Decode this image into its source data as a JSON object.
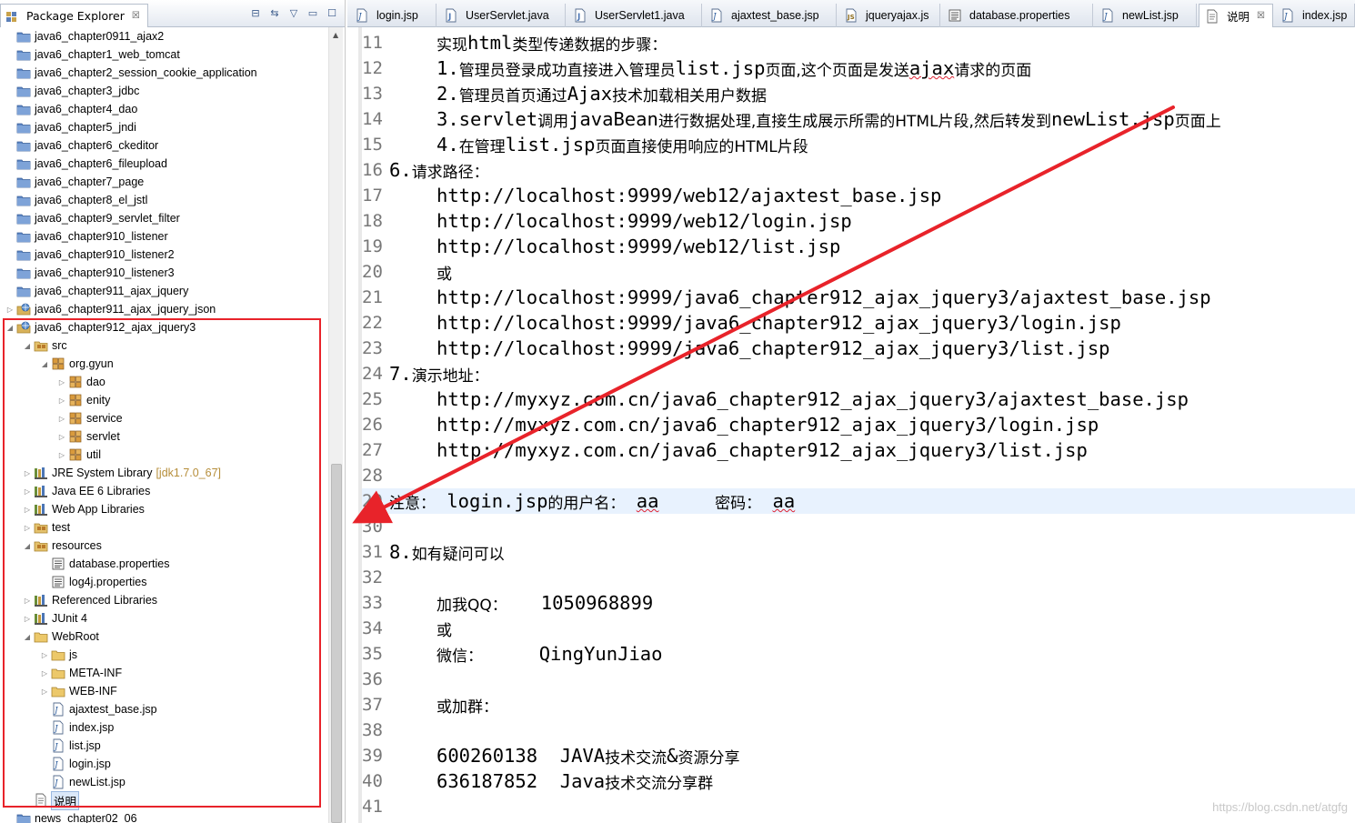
{
  "explorer": {
    "title": "Package Explorer",
    "tools": [
      "collapse-all-icon",
      "link-with-editor-icon",
      "view-menu-icon",
      "minimize-icon",
      "maximize-icon"
    ],
    "items": [
      {
        "label": "java6_chapter0911_ajax2",
        "level": 1,
        "icon": "project-icon",
        "twisty": ""
      },
      {
        "label": "java6_chapter1_web_tomcat",
        "level": 1,
        "icon": "project-icon",
        "twisty": ""
      },
      {
        "label": "java6_chapter2_session_cookie_application",
        "level": 1,
        "icon": "project-icon",
        "twisty": ""
      },
      {
        "label": "java6_chapter3_jdbc",
        "level": 1,
        "icon": "project-icon",
        "twisty": ""
      },
      {
        "label": "java6_chapter4_dao",
        "level": 1,
        "icon": "project-icon",
        "twisty": ""
      },
      {
        "label": "java6_chapter5_jndi",
        "level": 1,
        "icon": "project-icon",
        "twisty": ""
      },
      {
        "label": "java6_chapter6_ckeditor",
        "level": 1,
        "icon": "project-icon",
        "twisty": ""
      },
      {
        "label": "java6_chapter6_fileupload",
        "level": 1,
        "icon": "project-icon",
        "twisty": ""
      },
      {
        "label": "java6_chapter7_page",
        "level": 1,
        "icon": "project-icon",
        "twisty": ""
      },
      {
        "label": "java6_chapter8_el_jstl",
        "level": 1,
        "icon": "project-icon",
        "twisty": ""
      },
      {
        "label": "java6_chapter9_servlet_filter",
        "level": 1,
        "icon": "project-icon",
        "twisty": ""
      },
      {
        "label": "java6_chapter910_listener",
        "level": 1,
        "icon": "project-icon",
        "twisty": ""
      },
      {
        "label": "java6_chapter910_listener2",
        "level": 1,
        "icon": "project-icon",
        "twisty": ""
      },
      {
        "label": "java6_chapter910_listener3",
        "level": 1,
        "icon": "project-icon",
        "twisty": ""
      },
      {
        "label": "java6_chapter911_ajax_jquery",
        "level": 1,
        "icon": "project-icon",
        "twisty": ""
      },
      {
        "label": "java6_chapter911_ajax_jquery_json",
        "level": 1,
        "icon": "web-project-icon",
        "twisty": "collapsed"
      },
      {
        "label": "java6_chapter912_ajax_jquery3",
        "level": 1,
        "icon": "web-project-icon",
        "twisty": "expanded"
      },
      {
        "label": "src",
        "level": 2,
        "icon": "source-folder-icon",
        "twisty": "expanded"
      },
      {
        "label": "org.gyun",
        "level": 3,
        "icon": "package-icon",
        "twisty": "expanded"
      },
      {
        "label": "dao",
        "level": 4,
        "icon": "package-icon",
        "twisty": "collapsed"
      },
      {
        "label": "enity",
        "level": 4,
        "icon": "package-icon",
        "twisty": "collapsed"
      },
      {
        "label": "service",
        "level": 4,
        "icon": "package-icon",
        "twisty": "collapsed"
      },
      {
        "label": "servlet",
        "level": 4,
        "icon": "package-icon",
        "twisty": "collapsed"
      },
      {
        "label": "util",
        "level": 4,
        "icon": "package-icon",
        "twisty": "collapsed"
      },
      {
        "label": "JRE System Library",
        "decor": "[jdk1.7.0_67]",
        "level": 2,
        "icon": "library-icon",
        "twisty": "collapsed"
      },
      {
        "label": "Java EE 6 Libraries",
        "level": 2,
        "icon": "library-icon",
        "twisty": "collapsed"
      },
      {
        "label": "Web App Libraries",
        "level": 2,
        "icon": "library-icon",
        "twisty": "collapsed"
      },
      {
        "label": "test",
        "level": 2,
        "icon": "source-folder-icon",
        "twisty": "collapsed"
      },
      {
        "label": "resources",
        "level": 2,
        "icon": "source-folder-icon",
        "twisty": "expanded"
      },
      {
        "label": "database.properties",
        "level": 3,
        "icon": "properties-file-icon",
        "twisty": ""
      },
      {
        "label": "log4j.properties",
        "level": 3,
        "icon": "properties-file-icon",
        "twisty": ""
      },
      {
        "label": "Referenced Libraries",
        "level": 2,
        "icon": "library-icon",
        "twisty": "collapsed"
      },
      {
        "label": "JUnit 4",
        "level": 2,
        "icon": "library-icon",
        "twisty": "collapsed"
      },
      {
        "label": "WebRoot",
        "level": 2,
        "icon": "folder-icon",
        "twisty": "expanded"
      },
      {
        "label": "js",
        "level": 3,
        "icon": "folder-icon",
        "twisty": "collapsed"
      },
      {
        "label": "META-INF",
        "level": 3,
        "icon": "folder-icon",
        "twisty": "collapsed"
      },
      {
        "label": "WEB-INF",
        "level": 3,
        "icon": "folder-icon",
        "twisty": "collapsed"
      },
      {
        "label": "ajaxtest_base.jsp",
        "level": 3,
        "icon": "jsp-file-icon",
        "twisty": ""
      },
      {
        "label": "index.jsp",
        "level": 3,
        "icon": "jsp-file-icon",
        "twisty": ""
      },
      {
        "label": "list.jsp",
        "level": 3,
        "icon": "jsp-file-icon",
        "twisty": ""
      },
      {
        "label": "login.jsp",
        "level": 3,
        "icon": "jsp-file-icon",
        "twisty": ""
      },
      {
        "label": "newList.jsp",
        "level": 3,
        "icon": "jsp-file-icon",
        "twisty": ""
      },
      {
        "label": "说明",
        "level": 2,
        "icon": "text-file-icon",
        "twisty": "",
        "selected": true
      },
      {
        "label": "news_chapter02_06",
        "level": 1,
        "icon": "project-icon",
        "twisty": ""
      }
    ]
  },
  "editor": {
    "tabs": [
      {
        "label": "login.jsp",
        "icon": "jsp-file-icon",
        "active": false
      },
      {
        "label": "UserServlet.java",
        "icon": "java-file-icon",
        "active": false
      },
      {
        "label": "UserServlet1.java",
        "icon": "java-file-icon",
        "active": false
      },
      {
        "label": "ajaxtest_base.jsp",
        "icon": "jsp-file-icon",
        "active": false
      },
      {
        "label": "jqueryajax.js",
        "icon": "js-file-icon",
        "active": false
      },
      {
        "label": "database.properties",
        "icon": "properties-file-icon",
        "active": false
      },
      {
        "label": "newList.jsp",
        "icon": "jsp-file-icon",
        "active": false
      },
      {
        "label": "说明",
        "icon": "text-file-icon",
        "active": true,
        "close": "☒"
      },
      {
        "label": "index.jsp",
        "icon": "jsp-file-icon",
        "active": false
      }
    ],
    "lines": [
      {
        "n": "11",
        "indent": 2,
        "segs": [
          [
            "实现",
            "c"
          ],
          [
            "html",
            "m"
          ],
          [
            "类型传递数据的步骤：",
            "c"
          ]
        ]
      },
      {
        "n": "12",
        "indent": 2,
        "segs": [
          [
            "1.",
            "m"
          ],
          [
            "管理员登录成功直接进入管理员",
            "c"
          ],
          [
            "list.jsp",
            "m"
          ],
          [
            "页面,这个页面是发送",
            "c"
          ],
          [
            "ajax",
            "s"
          ],
          [
            "请求的页面",
            "c"
          ]
        ]
      },
      {
        "n": "13",
        "indent": 2,
        "segs": [
          [
            "2.",
            "m"
          ],
          [
            "管理员首页通过",
            "c"
          ],
          [
            "Ajax",
            "m"
          ],
          [
            "技术加载相关用户数据",
            "c"
          ]
        ]
      },
      {
        "n": "14",
        "indent": 2,
        "segs": [
          [
            "3.servlet",
            "m"
          ],
          [
            "调用",
            "c"
          ],
          [
            "javaBean",
            "m"
          ],
          [
            "进行数据处理,直接生成展示所需的HTML片段,然后转发到",
            "c"
          ],
          [
            "newList.jsp",
            "m"
          ],
          [
            "页面上",
            "c"
          ]
        ]
      },
      {
        "n": "15",
        "indent": 2,
        "segs": [
          [
            "4.",
            "m"
          ],
          [
            "在管理",
            "c"
          ],
          [
            "list.jsp",
            "m"
          ],
          [
            "页面直接使用响应的HTML片段",
            "c"
          ]
        ]
      },
      {
        "n": "16",
        "indent": 0,
        "segs": [
          [
            "6.",
            "m"
          ],
          [
            "请求路径：",
            "c"
          ]
        ]
      },
      {
        "n": "17",
        "indent": 2,
        "segs": [
          [
            "http://localhost:9999/web12/ajaxtest_base.jsp",
            "m"
          ]
        ]
      },
      {
        "n": "18",
        "indent": 2,
        "segs": [
          [
            "http://localhost:9999/web12/login.jsp",
            "m"
          ]
        ]
      },
      {
        "n": "19",
        "indent": 2,
        "segs": [
          [
            "http://localhost:9999/web12/list.jsp",
            "m"
          ]
        ]
      },
      {
        "n": "20",
        "indent": 2,
        "segs": [
          [
            "或",
            "c"
          ]
        ]
      },
      {
        "n": "21",
        "indent": 2,
        "segs": [
          [
            "http://localhost:9999/java6_chapter912_ajax_jquery3/ajaxtest_base.jsp",
            "m"
          ]
        ]
      },
      {
        "n": "22",
        "indent": 2,
        "segs": [
          [
            "http://localhost:9999/java6_chapter912_ajax_jquery3/login.jsp",
            "m"
          ]
        ]
      },
      {
        "n": "23",
        "indent": 2,
        "segs": [
          [
            "http://localhost:9999/java6_chapter912_ajax_jquery3/list.jsp",
            "m"
          ]
        ]
      },
      {
        "n": "24",
        "indent": 0,
        "segs": [
          [
            "7.",
            "m"
          ],
          [
            "演示地址：",
            "c"
          ]
        ]
      },
      {
        "n": "25",
        "indent": 2,
        "segs": [
          [
            "http://myxyz.com.cn/java6_chapter912_ajax_jquery3/ajaxtest_base.jsp",
            "m"
          ]
        ]
      },
      {
        "n": "26",
        "indent": 2,
        "segs": [
          [
            "http://myxyz.com.cn/java6_chapter912_ajax_jquery3/login.jsp",
            "m"
          ]
        ]
      },
      {
        "n": "27",
        "indent": 2,
        "segs": [
          [
            "http://myxyz.com.cn/java6_chapter912_ajax_jquery3/list.jsp",
            "m"
          ]
        ]
      },
      {
        "n": "28",
        "indent": 0,
        "segs": []
      },
      {
        "n": "29",
        "indent": 0,
        "current": true,
        "segs": [
          [
            "注意：",
            "c"
          ],
          [
            " login.jsp",
            "m"
          ],
          [
            "的用户名：",
            "c"
          ],
          [
            " ",
            "m"
          ],
          [
            "aa",
            "s"
          ],
          [
            "     ",
            "m"
          ],
          [
            "密码：",
            "c"
          ],
          [
            " ",
            "m"
          ],
          [
            "aa",
            "s"
          ]
        ]
      },
      {
        "n": "30",
        "indent": 0,
        "segs": []
      },
      {
        "n": "31",
        "indent": 0,
        "segs": [
          [
            "8.",
            "m"
          ],
          [
            "如有疑问可以",
            "c"
          ]
        ]
      },
      {
        "n": "32",
        "indent": 0,
        "segs": []
      },
      {
        "n": "33",
        "indent": 2,
        "segs": [
          [
            "加我QQ：",
            "c"
          ],
          [
            "   1050968899",
            "m"
          ]
        ]
      },
      {
        "n": "34",
        "indent": 2,
        "segs": [
          [
            "或",
            "c"
          ]
        ]
      },
      {
        "n": "35",
        "indent": 2,
        "segs": [
          [
            "微信：",
            "c"
          ],
          [
            "     QingYunJiao",
            "m"
          ]
        ]
      },
      {
        "n": "36",
        "indent": 0,
        "segs": []
      },
      {
        "n": "37",
        "indent": 2,
        "segs": [
          [
            "或加群：",
            "c"
          ]
        ]
      },
      {
        "n": "38",
        "indent": 0,
        "segs": []
      },
      {
        "n": "39",
        "indent": 2,
        "segs": [
          [
            "600260138  JAVA",
            "m"
          ],
          [
            "技术交流",
            "c"
          ],
          [
            "&",
            "m"
          ],
          [
            "资源分享",
            "c"
          ]
        ]
      },
      {
        "n": "40",
        "indent": 2,
        "segs": [
          [
            "636187852  Java",
            "m"
          ],
          [
            "技术交流分享群",
            "c"
          ]
        ]
      },
      {
        "n": "41",
        "indent": 0,
        "segs": []
      }
    ]
  },
  "annotation": {
    "box_color": "#e8232a",
    "arrow_color": "#e8232a"
  },
  "watermark": "https://blog.csdn.net/atgfg",
  "colors": {
    "selection": "#dbe8f9",
    "current_line": "#e8f2fe",
    "line_number": "#787878",
    "decoration": "#b68e3a"
  }
}
